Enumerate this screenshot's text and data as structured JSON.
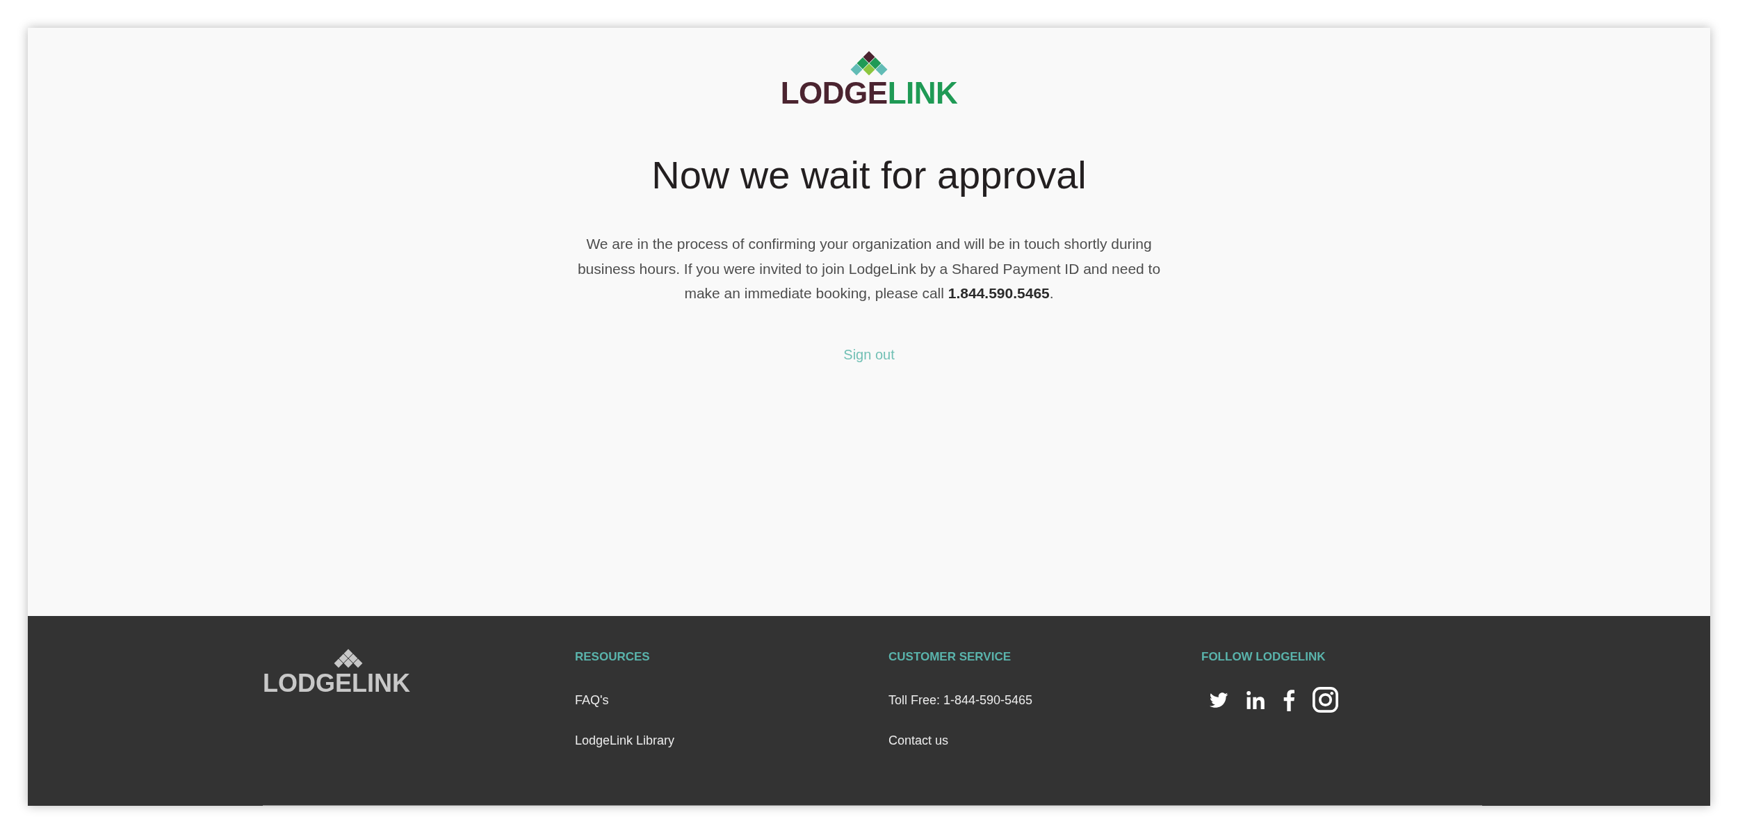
{
  "logo": {
    "dark_part": "LODGE",
    "green_part": "LINK"
  },
  "heading": "Now we wait for approval",
  "message": "We are in the process of confirming your organization and will be in touch shortly during business hours. If you were invited to join LodgeLink by a Shared Payment ID and need to make an immediate booking, please call **1.844.590.5465**.",
  "sign_out": "Sign out",
  "footer": {
    "logo": "LODGELINK",
    "columns": [
      {
        "heading": "RESOURCES",
        "links": [
          "FAQ's",
          "LodgeLink Library"
        ]
      },
      {
        "heading": "CUSTOMER SERVICE",
        "links": [
          "Toll Free: 1-844-590-5465",
          "Contact us"
        ]
      }
    ],
    "follow": {
      "heading": "FOLLOW LODGELINK"
    }
  }
}
